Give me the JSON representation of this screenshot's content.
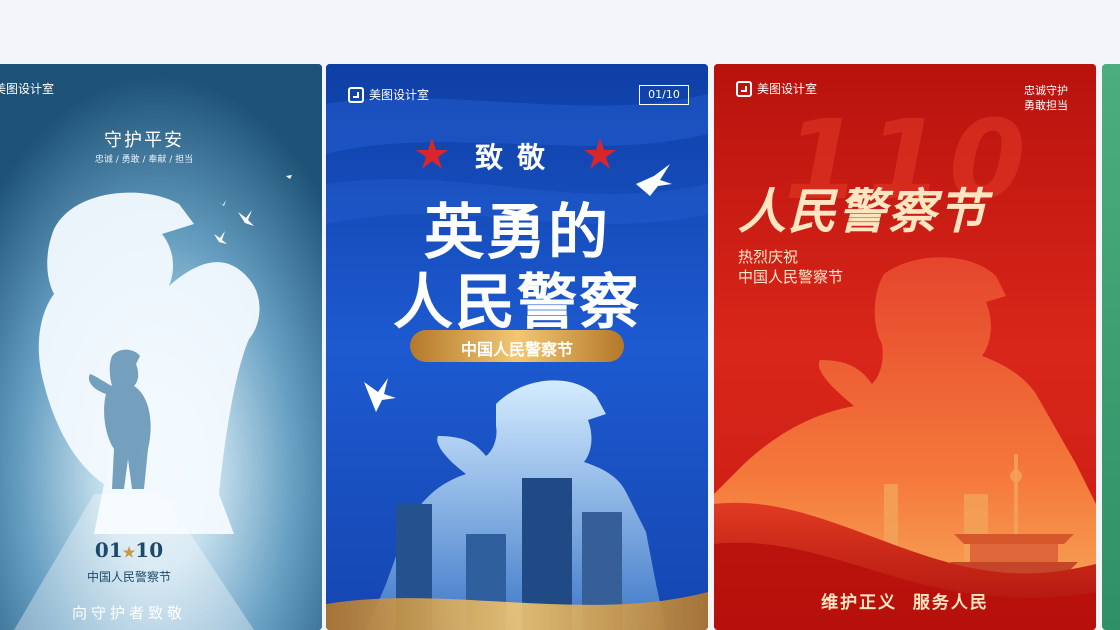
{
  "brand": "美图设计室",
  "cards": [
    {
      "id": "card-1",
      "title": "守护平安",
      "tags": "忠诚 / 勇敢 / 奉献 / 担当",
      "date_left": "01",
      "star": "★",
      "date_right": "10",
      "festival": "中国人民警察节",
      "footer": "向守护者致敬"
    },
    {
      "id": "card-2",
      "date_badge": "01/10",
      "salute": "致敬",
      "headline_1": "英勇的",
      "headline_2": "人民警察",
      "ribbon": "中国人民警察节"
    },
    {
      "id": "card-3",
      "motto_1": "忠诚守护",
      "motto_2": "勇敢担当",
      "number_watermark": "110",
      "headline": "人民警察节",
      "sub_1": "热烈庆祝",
      "sub_2": "中国人民警察节",
      "footer": "维护正义  服务人民"
    }
  ],
  "colors": {
    "page_bg": "#f4f5f9",
    "card1_bg": "#1f5a7c",
    "card2_bg": "#1449b8",
    "card3_bg": "#c4170f",
    "gold": "#d6a24a",
    "star_red": "#d9262b"
  }
}
